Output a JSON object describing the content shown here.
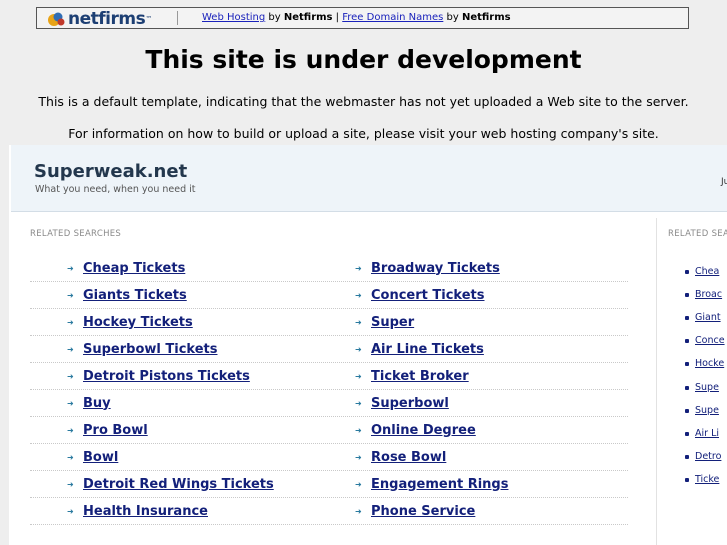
{
  "banner": {
    "logo_text": "netfirms",
    "logo_tm": "™",
    "link_hosting": "Web Hosting",
    "by1": " by ",
    "brand1": "Netfirms",
    "sep": " | ",
    "link_domains": "Free Domain Names",
    "by2": " by ",
    "brand2": "Netfirms"
  },
  "notice": {
    "title": "This site is under development",
    "line1": "This is a default template, indicating that the webmaster has not yet uploaded a Web site to the server.",
    "line2": "For information on how to build or upload a site, please visit your web hosting company's site."
  },
  "parked": {
    "site_name": "Superweak.net",
    "tagline": "What you need, when you need it",
    "header_cut": "Ju",
    "related_label": "RELATED SEARCHES",
    "related_label_right": "RELATED SEA",
    "rows": [
      {
        "left": "Cheap Tickets",
        "right": "Broadway Tickets"
      },
      {
        "left": "Giants Tickets",
        "right": "Concert Tickets"
      },
      {
        "left": "Hockey Tickets",
        "right": "Super"
      },
      {
        "left": "Superbowl Tickets",
        "right": "Air Line Tickets"
      },
      {
        "left": "Detroit Pistons Tickets",
        "right": "Ticket Broker"
      },
      {
        "left": "Buy",
        "right": "Superbowl"
      },
      {
        "left": "Pro Bowl",
        "right": "Online Degree"
      },
      {
        "left": "Bowl",
        "right": "Rose Bowl"
      },
      {
        "left": "Detroit Red Wings Tickets",
        "right": "Engagement Rings"
      },
      {
        "left": "Health Insurance",
        "right": "Phone Service"
      }
    ],
    "side_items": [
      "Chea",
      "Broac",
      "Giant",
      "Conce",
      "Hocke",
      "Supe",
      "Supe",
      "Air Li",
      "Detro",
      "Ticke"
    ]
  },
  "colors": {
    "link": "#13207a",
    "arrow": "#2a7a9f",
    "banner_link": "#1a22bb"
  },
  "icons": {
    "logo": "netfirms-logo-icon",
    "arrow": "right-arrow-icon",
    "bullet": "square-bullet-icon"
  }
}
